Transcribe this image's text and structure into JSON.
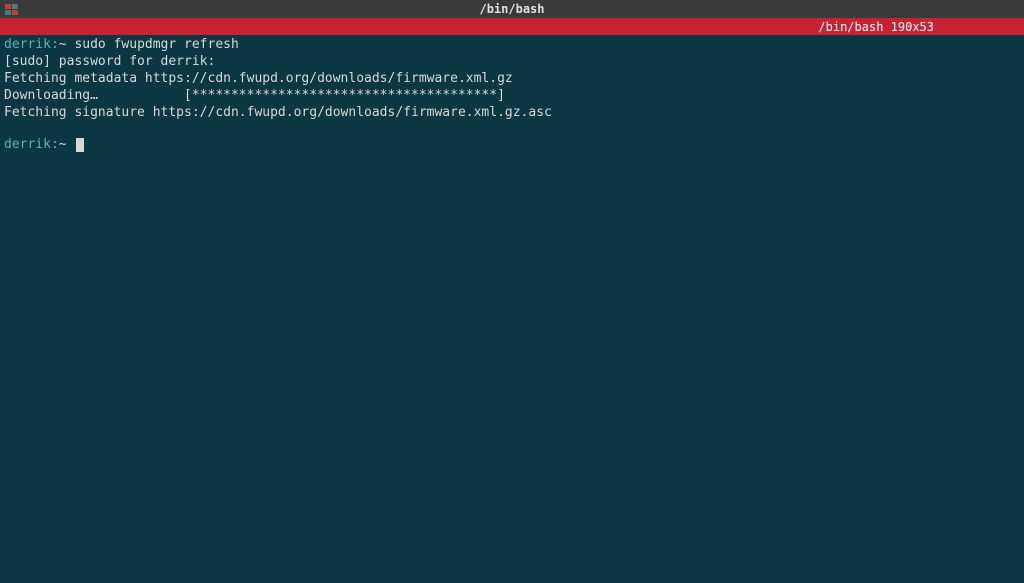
{
  "titlebar": {
    "title": "/bin/bash"
  },
  "statusbar": {
    "text": "/bin/bash 190x53"
  },
  "terminal": {
    "prompt1_user": "derrik",
    "prompt1_sep": ":",
    "prompt1_path": "~ ",
    "line1_cmd": "sudo fwupdmgr refresh",
    "line2": "[sudo] password for derrik:",
    "line3": "Fetching metadata https://cdn.fwupd.org/downloads/firmware.xml.gz",
    "line4": "Downloading…           [***************************************]",
    "line5": "Fetching signature https://cdn.fwupd.org/downloads/firmware.xml.gz.asc",
    "prompt2_user": "derrik",
    "prompt2_sep": ":",
    "prompt2_path": "~ "
  }
}
